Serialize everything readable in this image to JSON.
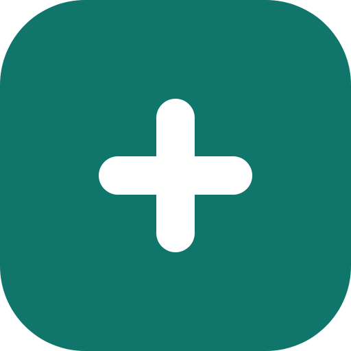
{
  "add_button": {
    "icon": "plus-icon",
    "background_color": "#10766c",
    "icon_color": "#ffffff"
  }
}
